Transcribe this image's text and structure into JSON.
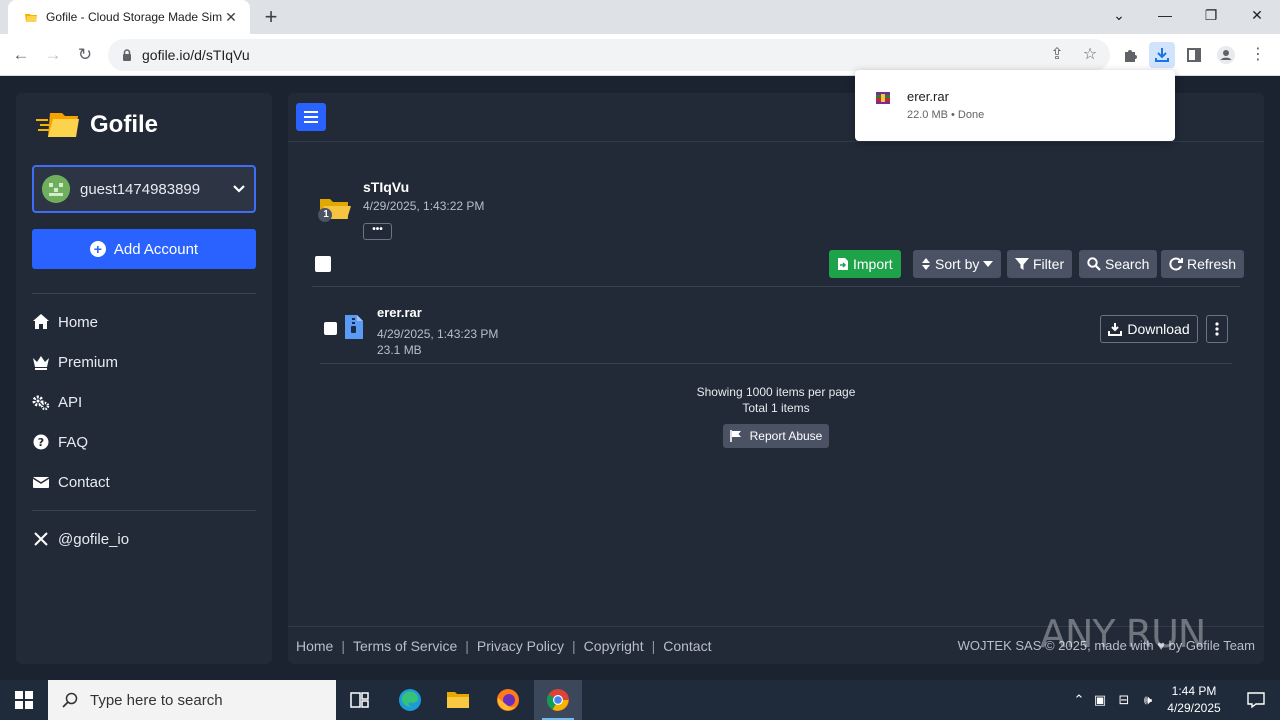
{
  "browser": {
    "tab_title": "Gofile - Cloud Storage Made Sim",
    "url": "gofile.io/d/sTIqVu",
    "download_bubble": {
      "file_name": "erer.rar",
      "status": "22.0 MB • Done"
    }
  },
  "sidebar": {
    "brand": "Gofile",
    "account_name": "guest1474983899",
    "add_account_label": "Add Account",
    "nav": [
      {
        "label": "Home",
        "icon": "home-icon"
      },
      {
        "label": "Premium",
        "icon": "crown-icon"
      },
      {
        "label": "API",
        "icon": "cogs-icon"
      },
      {
        "label": "FAQ",
        "icon": "question-icon"
      },
      {
        "label": "Contact",
        "icon": "envelope-icon"
      }
    ],
    "social": "@gofile_io"
  },
  "folder": {
    "name": "sTIqVu",
    "date": "4/29/2025, 1:43:22 PM",
    "badge": "1",
    "more_label": "•••"
  },
  "toolbar": {
    "import_label": "Import",
    "sort_label": "Sort by",
    "filter_label": "Filter",
    "search_label": "Search",
    "refresh_label": "Refresh"
  },
  "files": [
    {
      "name": "erer.rar",
      "date": "4/29/2025, 1:43:23 PM",
      "size": "23.1 MB",
      "download_label": "Download"
    }
  ],
  "pagination": {
    "per_page": "Showing 1000 items per page",
    "total": "Total 1 items"
  },
  "report_label": "Report Abuse",
  "footer": {
    "links": [
      "Home",
      "Terms of Service",
      "Privacy Policy",
      "Copyright",
      "Contact"
    ],
    "copyright": "WOJTEK SAS © 2025, made with ♥ by Gofile Team"
  },
  "watermark": "ANY RUN",
  "taskbar": {
    "search_placeholder": "Type here to search",
    "time": "1:44 PM",
    "date": "4/29/2025"
  },
  "colors": {
    "accent": "#2962ff",
    "import": "#1fa34a",
    "panel": "#222a38",
    "background": "#1b2230"
  }
}
